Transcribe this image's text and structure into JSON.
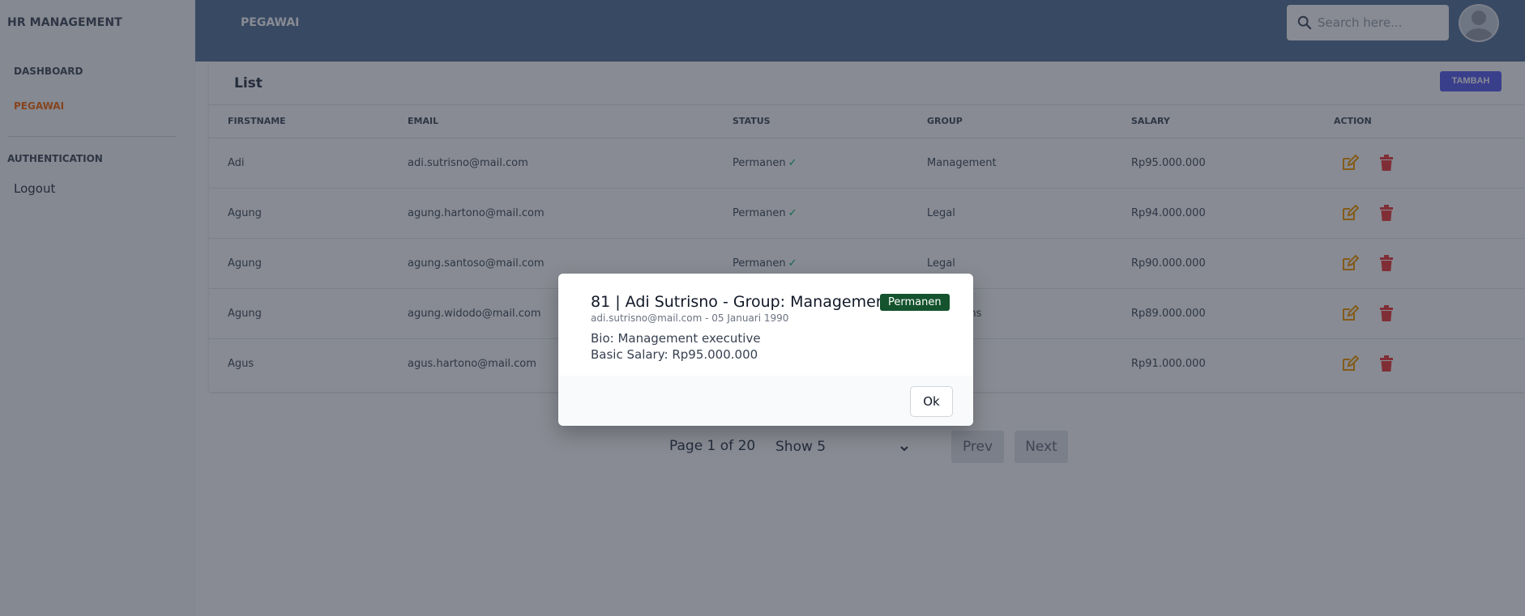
{
  "sidebar": {
    "brand": "HR MANAGEMENT",
    "items": [
      {
        "label": "DASHBOARD"
      },
      {
        "label": "PEGAWAI"
      }
    ],
    "section": "AUTHENTICATION",
    "logout": "Logout"
  },
  "header": {
    "title": "PEGAWAI",
    "search_placeholder": "Search here..."
  },
  "card": {
    "title": "List",
    "add_label": "TAMBAH",
    "columns": [
      "FIRSTNAME",
      "EMAIL",
      "STATUS",
      "GROUP",
      "SALARY",
      "ACTION"
    ],
    "rows": [
      {
        "firstname": "Adi",
        "email": "adi.sutrisno@mail.com",
        "status": "Permanen",
        "group": "Management",
        "salary": "Rp95.000.000"
      },
      {
        "firstname": "Agung",
        "email": "agung.hartono@mail.com",
        "status": "Permanen",
        "group": "Legal",
        "salary": "Rp94.000.000"
      },
      {
        "firstname": "Agung",
        "email": "agung.santoso@mail.com",
        "status": "Permanen",
        "group": "Legal",
        "salary": "Rp90.000.000"
      },
      {
        "firstname": "Agung",
        "email": "agung.widodo@mail.com",
        "status": "",
        "group": "...ns",
        "salary": "Rp89.000.000"
      },
      {
        "firstname": "Agus",
        "email": "agus.hartono@mail.com",
        "status": "",
        "group": "",
        "salary": "Rp91.000.000"
      }
    ]
  },
  "pagination": {
    "page_info": "Page 1 of 20",
    "show": "Show 5",
    "prev": "Prev",
    "next": "Next"
  },
  "modal": {
    "title": "81 | Adi Sutrisno - Group: Management",
    "badge": "Permanen",
    "subtitle": "adi.sutrisno@mail.com - 05 Januari 1990",
    "bio": "Bio: Management executive",
    "salary": "Basic Salary: Rp95.000.000",
    "ok": "Ok"
  },
  "colors": {
    "header": "#5f7a9f",
    "accent": "#f97316",
    "primary": "#6366f1",
    "badge": "#14532d",
    "check": "#10b981",
    "edit_icon": "#f59e0b",
    "delete_icon": "#ef4444"
  },
  "icons": {
    "search": "search-icon",
    "avatar": "user-avatar",
    "edit": "edit-icon",
    "delete": "trash-icon",
    "check": "check-icon",
    "chevron": "chevron-down-icon"
  }
}
